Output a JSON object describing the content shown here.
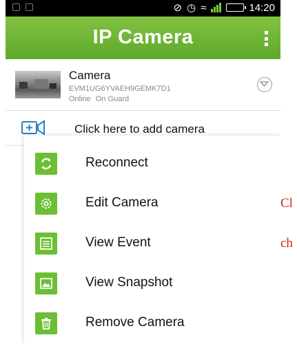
{
  "status_bar": {
    "time": "14:20",
    "icons": [
      "notification-icon",
      "notification-icon",
      "no-sound-icon",
      "alarm-icon",
      "wifi-icon",
      "signal-icon",
      "battery-icon"
    ]
  },
  "app_bar": {
    "title": "IP Camera",
    "menu_icon": "overflow-menu-icon"
  },
  "camera": {
    "name": "Camera",
    "id": "EVM1UG6YVAEH9GEMK7D1",
    "status_online": "Online",
    "status_guard": "On Guard",
    "expand_icon": "chevron-circle-icon"
  },
  "add_camera": {
    "label": "Click here to add camera",
    "icon": "add-camera-icon"
  },
  "context_menu": {
    "items": [
      {
        "label": "Reconnect",
        "icon": "reconnect-icon"
      },
      {
        "label": "Edit Camera",
        "icon": "gear-icon"
      },
      {
        "label": "View Event",
        "icon": "list-icon"
      },
      {
        "label": "View Snapshot",
        "icon": "image-icon"
      },
      {
        "label": "Remove Camera",
        "icon": "trash-icon"
      }
    ]
  },
  "side_text": {
    "line1": "Cl",
    "line2": "ch"
  },
  "colors": {
    "accent_green": "#6cbf34",
    "status_bar": "#000000",
    "annotation_red": "#d22020"
  }
}
